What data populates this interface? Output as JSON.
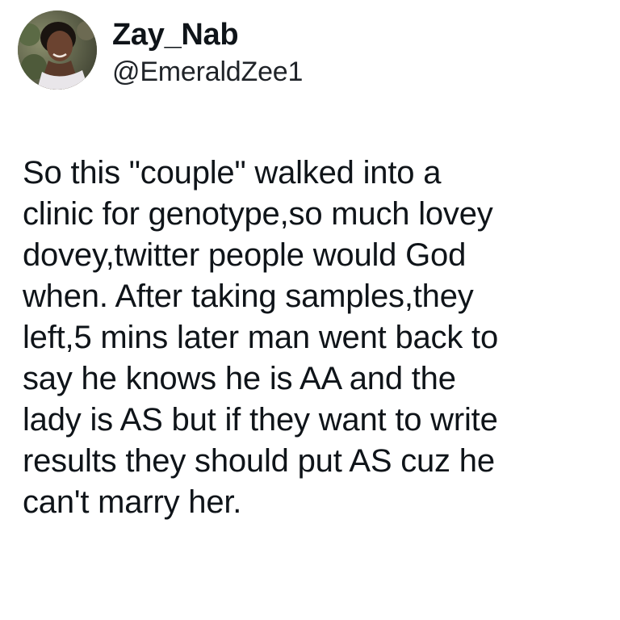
{
  "user": {
    "display_name": "Zay_Nab",
    "handle": "@EmeraldZee1"
  },
  "tweet": {
    "lines": [
      "So this \"couple\" walked into a",
      "clinic for genotype,so much lovey",
      "dovey,twitter people would God",
      "when. After taking samples,they",
      "left,5 mins later man went back to",
      "say he knows he is AA and the",
      "lady is AS but if they want to write",
      "results they should put AS cuz he",
      "can't marry her."
    ]
  },
  "icons": {
    "avatar": "profile-photo"
  }
}
